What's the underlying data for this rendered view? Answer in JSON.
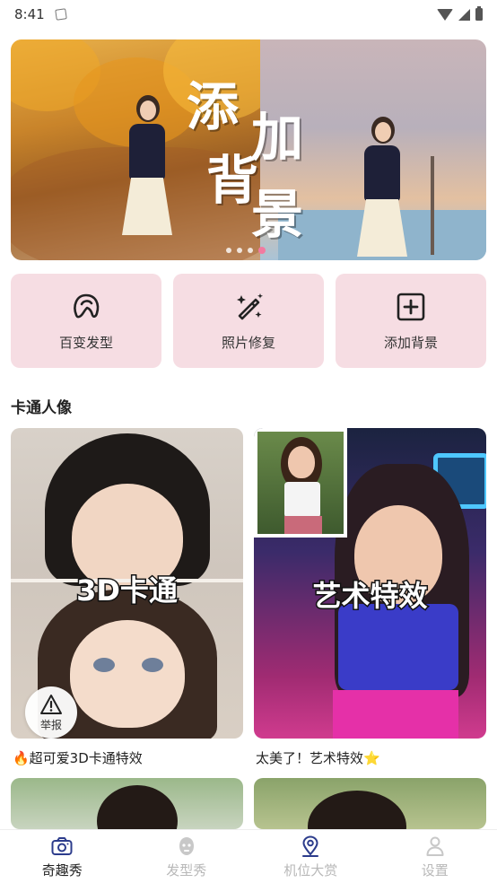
{
  "status_bar": {
    "time": "8:41"
  },
  "banner": {
    "title_chars": [
      "添",
      "加",
      "背",
      "景"
    ],
    "slide_count": 4,
    "active_slide": 4
  },
  "quick_actions": [
    {
      "label": "百变发型",
      "icon": "hair-icon"
    },
    {
      "label": "照片修复",
      "icon": "magic-wand-icon"
    },
    {
      "label": "添加背景",
      "icon": "add-square-icon"
    }
  ],
  "section": {
    "title": "卡通人像"
  },
  "cards": [
    {
      "overlay": "3D卡通",
      "caption": "🔥超可爱3D卡通特效",
      "report_label": "举报"
    },
    {
      "overlay": "艺术特效",
      "caption": "太美了！艺术特效⭐"
    }
  ],
  "bottom_nav": [
    {
      "label": "奇趣秀",
      "icon": "camera-icon",
      "active": true
    },
    {
      "label": "发型秀",
      "icon": "face-icon",
      "active": false
    },
    {
      "label": "机位大赏",
      "icon": "location-pin-icon",
      "active": false
    },
    {
      "label": "设置",
      "icon": "person-icon",
      "active": false
    }
  ],
  "colors": {
    "quick_card_bg": "#f6dde3",
    "active_dot": "#f27aa0",
    "nav_inactive": "#b8b8b8"
  }
}
